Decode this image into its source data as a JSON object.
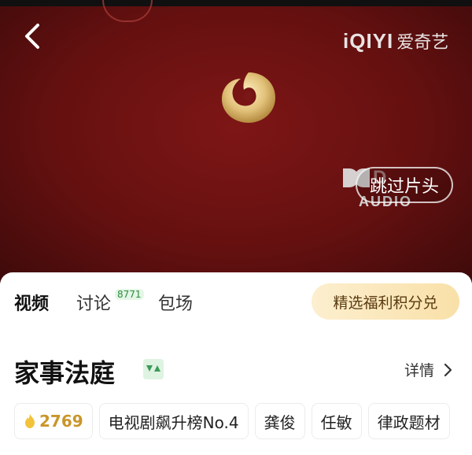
{
  "player": {
    "brand_latin": "iQIYI",
    "brand_cn": "爱奇艺",
    "dolby_word": "D",
    "dolby_audio": "AUDIO",
    "skip_label": "跳过片头",
    "colors": {
      "background": "#651010",
      "logo_gold": "#e2c27a"
    }
  },
  "tabs": [
    {
      "label": "视频",
      "active": true
    },
    {
      "label": "讨论",
      "badge": "8771"
    },
    {
      "label": "包场"
    }
  ],
  "promo_button": "精选福利积分兑",
  "show": {
    "title": "家事法庭",
    "details_label": "详情",
    "heat": "2769",
    "tags": [
      "电视剧飙升榜No.4",
      "龚俊",
      "任敏",
      "律政题材"
    ]
  }
}
